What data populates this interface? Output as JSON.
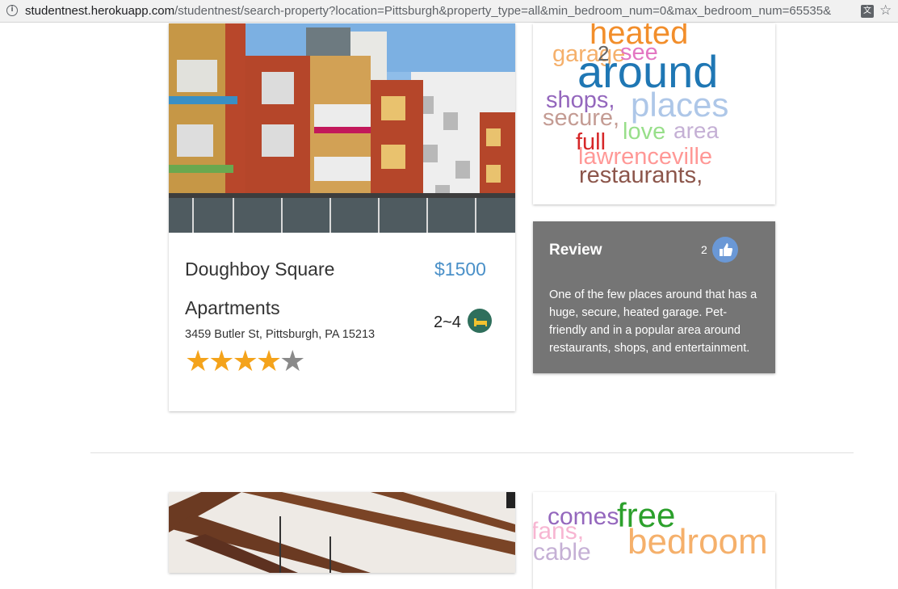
{
  "browser": {
    "url_host": "studentnest.herokuapp.com",
    "url_rest": "/studentnest/search-property?location=Pittsburgh&property_type=all&min_bedroom_num=0&max_bedroom_num=65535&",
    "info_icon": "info-icon",
    "translate_icon": "translate-icon",
    "bookmark_icon": "star-icon"
  },
  "listing1": {
    "title_line1": "Doughboy Square",
    "title_line2": "Apartments",
    "price": "$1500",
    "address": "3459 Butler St, Pittsburgh, PA 15213",
    "bedrooms": "2~4",
    "bed_icon": "bed-icon",
    "rating": 4,
    "rating_max": 5
  },
  "wordcloud1": {
    "words": [
      {
        "text": "heated",
        "color": "#f28e2b"
      },
      {
        "text": "garage",
        "color": "#f5b06b"
      },
      {
        "text": "2",
        "color": "#666666"
      },
      {
        "text": "see",
        "color": "#e377c2"
      },
      {
        "text": "around",
        "color": "#1f77b4"
      },
      {
        "text": "shops,",
        "color": "#9467bd"
      },
      {
        "text": "places",
        "color": "#aec7e8"
      },
      {
        "text": "secure,",
        "color": "#c49c94"
      },
      {
        "text": "love",
        "color": "#98df8a"
      },
      {
        "text": "area",
        "color": "#c5b0d5"
      },
      {
        "text": "full",
        "color": "#d62728"
      },
      {
        "text": "lawrenceville",
        "color": "#ff9896"
      },
      {
        "text": "restaurants,",
        "color": "#8c564b"
      }
    ]
  },
  "review": {
    "title": "Review",
    "likes": "2",
    "thumb_icon": "thumbs-up-icon",
    "text": "One of the few places around that has a huge, secure, heated garage. Pet-friendly and in a popular area around restaurants, shops, and entertainment."
  },
  "wordcloud2": {
    "words": [
      {
        "text": "comes",
        "color": "#9467bd"
      },
      {
        "text": "free",
        "color": "#2ca02c"
      },
      {
        "text": "fans,",
        "color": "#f7b6d2"
      },
      {
        "text": "bedroom",
        "color": "#f5b06b"
      },
      {
        "text": "cable",
        "color": "#c5b0d5"
      }
    ]
  },
  "colors": {
    "price": "#4a90c8",
    "review_bg": "#757575",
    "star_on": "#f4a31b",
    "star_off": "#8a8a8a"
  }
}
